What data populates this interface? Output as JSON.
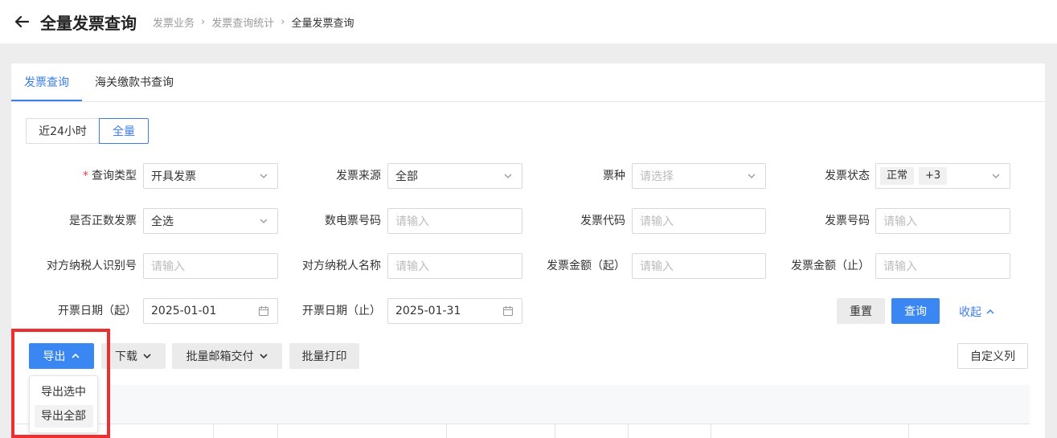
{
  "header": {
    "title": "全量发票查询",
    "breadcrumb": [
      "发票业务",
      "发票查询统计",
      "全量发票查询"
    ]
  },
  "tabs": [
    {
      "label": "发票查询",
      "active": true
    },
    {
      "label": "海关缴款书查询",
      "active": false
    }
  ],
  "time_range": [
    {
      "label": "近24小时",
      "active": false
    },
    {
      "label": "全量",
      "active": true
    }
  ],
  "form": {
    "query_type": {
      "label": "查询类型",
      "value": "开具发票"
    },
    "invoice_source": {
      "label": "发票来源",
      "value": "全部"
    },
    "ticket_type": {
      "label": "票种",
      "placeholder": "请选择"
    },
    "invoice_status": {
      "label": "发票状态",
      "tags": [
        "正常",
        "+3"
      ]
    },
    "is_positive": {
      "label": "是否正数发票",
      "value": "全选"
    },
    "digital_number": {
      "label": "数电票号码",
      "placeholder": "请输入"
    },
    "invoice_code": {
      "label": "发票代码",
      "placeholder": "请输入"
    },
    "invoice_number": {
      "label": "发票号码",
      "placeholder": "请输入"
    },
    "counter_taxid": {
      "label": "对方纳税人识别号",
      "placeholder": "请输入"
    },
    "counter_name": {
      "label": "对方纳税人名称",
      "placeholder": "请输入"
    },
    "amount_from": {
      "label": "发票金额（起）",
      "placeholder": "请输入"
    },
    "amount_to": {
      "label": "发票金额（止）",
      "placeholder": "请输入"
    },
    "date_from": {
      "label": "开票日期（起）",
      "value": "2025-01-01"
    },
    "date_to": {
      "label": "开票日期（止）",
      "value": "2025-01-31"
    }
  },
  "actions": {
    "reset": "重置",
    "query": "查询",
    "collapse": "收起"
  },
  "toolbar": {
    "export": "导出",
    "download": "下载",
    "batch_mail": "批量邮箱交付",
    "batch_print": "批量打印",
    "custom_columns": "自定义列"
  },
  "export_menu": [
    "导出选中",
    "导出全部"
  ],
  "colors": {
    "accent": "#3a7ee8",
    "primary_button": "#3a86f2",
    "highlight": "#ee2f2f"
  }
}
